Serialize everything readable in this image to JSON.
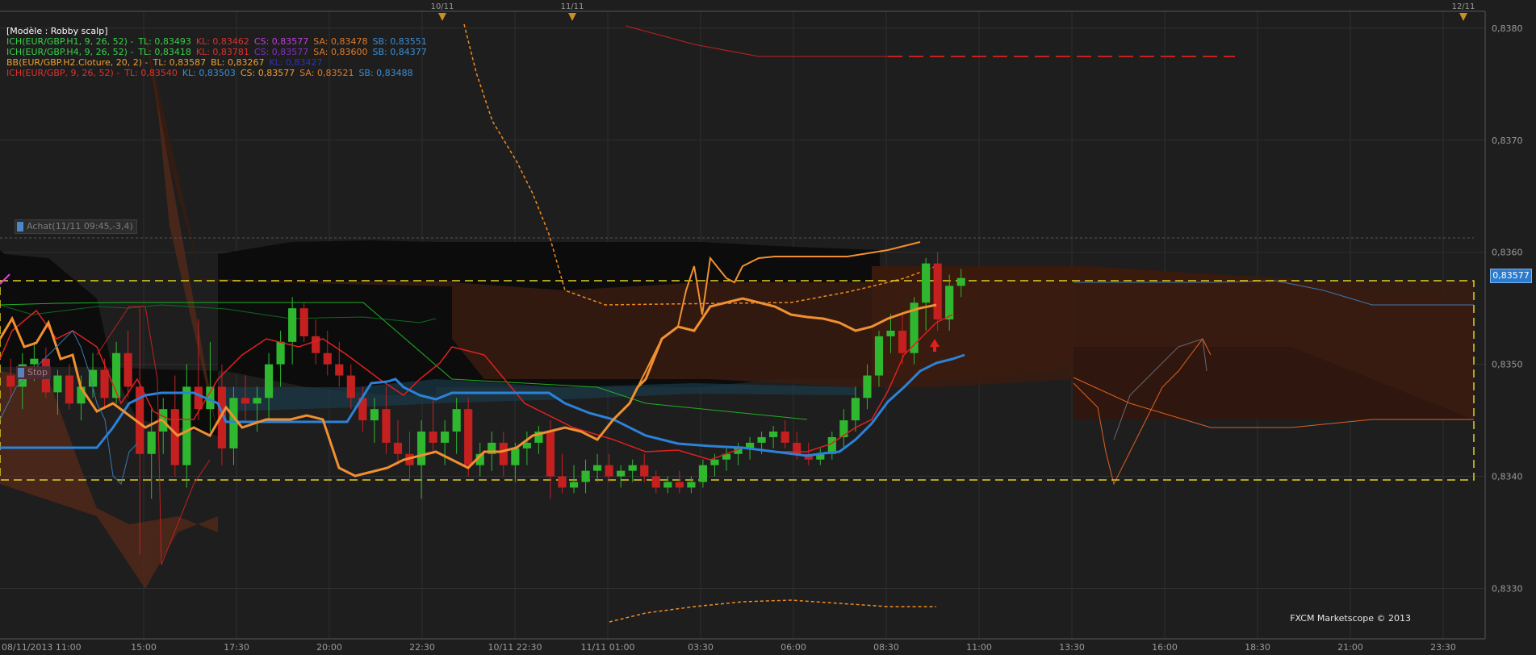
{
  "legend": {
    "model": "[Modèle : Robby scalp]",
    "rows": [
      [
        {
          "text": "ICH(EUR/GBP.H1, 9, 26, 52) -",
          "color": "#36d14a"
        },
        {
          "text": "TL: 0,83493",
          "color": "#36d14a"
        },
        {
          "text": "KL: 0,83462",
          "color": "#e03030"
        },
        {
          "text": "CS: 0,83577",
          "color": "#c040e0"
        },
        {
          "text": "SA: 0,83478",
          "color": "#e07a2a"
        },
        {
          "text": "SB: 0,83551",
          "color": "#3a8fd8"
        }
      ],
      [
        {
          "text": "ICH(EUR/GBP.H4, 9, 26, 52) -",
          "color": "#36d14a"
        },
        {
          "text": "TL: 0,83418",
          "color": "#36d14a"
        },
        {
          "text": "KL: 0,83781",
          "color": "#e03030"
        },
        {
          "text": "CS: 0,83577",
          "color": "#8030c0"
        },
        {
          "text": "SA: 0,83600",
          "color": "#e07a2a"
        },
        {
          "text": "SB: 0,84377",
          "color": "#3a8fd8"
        }
      ],
      [
        {
          "text": "BB(EUR/GBP.H2.Cloture, 20, 2) -",
          "color": "#f0a030"
        },
        {
          "text": "TL: 0,83587",
          "color": "#f0a030"
        },
        {
          "text": "BL: 0,83267",
          "color": "#f0a030"
        },
        {
          "text": "KL: 0,83427",
          "color": "#3030c0"
        }
      ],
      [
        {
          "text": "ICH(EUR/GBP, 9, 26, 52) -",
          "color": "#e03030"
        },
        {
          "text": "TL: 0,83540",
          "color": "#e03030"
        },
        {
          "text": "KL: 0,83503",
          "color": "#3a8fd8"
        },
        {
          "text": "CS: 0,83577",
          "color": "#f0a030"
        },
        {
          "text": "SA: 0,83521",
          "color": "#e07a2a"
        },
        {
          "text": "SB: 0,83488",
          "color": "#3a8fd8"
        }
      ]
    ]
  },
  "order_label": "Achat(11/11 09:45,-3,4)",
  "stop_label": "Stop",
  "current_price": "0,83577",
  "copyright": "FXCM Marketscope © 2013",
  "chart_data": {
    "type": "candlestick",
    "instrument": "EUR/GBP",
    "y_ticks": [
      "0,8380",
      "0,8370",
      "0,8360",
      "0,8350",
      "0,8340",
      "0,8330"
    ],
    "ylim": [
      0.83255,
      0.83815
    ],
    "x_ticks": [
      "08/11/2013 11:00",
      "15:00",
      "17:30",
      "20:00",
      "22:30",
      "10/11 22:30",
      "11/11 01:00",
      "03:30",
      "06:00",
      "08:30",
      "11:00",
      "13:30",
      "16:00",
      "18:30",
      "21:00",
      "23:30"
    ],
    "top_date_markers": [
      "10/11",
      "11/11",
      "12/11"
    ],
    "colors": {
      "up": "#2fb82f",
      "down": "#c42020",
      "background": "#1e1e1e",
      "grid": "#2e2e2e"
    },
    "candles": [
      [
        0.8349,
        0.83505,
        0.8347,
        0.8348
      ],
      [
        0.8348,
        0.8351,
        0.8346,
        0.835
      ],
      [
        0.835,
        0.8352,
        0.83485,
        0.83505
      ],
      [
        0.83505,
        0.83515,
        0.8347,
        0.83475
      ],
      [
        0.83475,
        0.83495,
        0.83455,
        0.8349
      ],
      [
        0.8349,
        0.835,
        0.8346,
        0.83465
      ],
      [
        0.83465,
        0.8349,
        0.8345,
        0.8348
      ],
      [
        0.8348,
        0.8351,
        0.8347,
        0.83495
      ],
      [
        0.83495,
        0.83505,
        0.8346,
        0.8347
      ],
      [
        0.8347,
        0.8352,
        0.83465,
        0.8351
      ],
      [
        0.8351,
        0.8353,
        0.8347,
        0.8348
      ],
      [
        0.8348,
        0.8355,
        0.8333,
        0.8342
      ],
      [
        0.8342,
        0.8346,
        0.8338,
        0.8344
      ],
      [
        0.8344,
        0.8347,
        0.8342,
        0.8346
      ],
      [
        0.8346,
        0.8349,
        0.834,
        0.8341
      ],
      [
        0.8341,
        0.835,
        0.8339,
        0.8348
      ],
      [
        0.8348,
        0.8354,
        0.8345,
        0.8346
      ],
      [
        0.8346,
        0.8352,
        0.8344,
        0.8348
      ],
      [
        0.8348,
        0.835,
        0.8341,
        0.83425
      ],
      [
        0.83425,
        0.8348,
        0.8341,
        0.8347
      ],
      [
        0.8347,
        0.8349,
        0.8345,
        0.83465
      ],
      [
        0.83465,
        0.8348,
        0.8344,
        0.8347
      ],
      [
        0.8347,
        0.8351,
        0.8345,
        0.835
      ],
      [
        0.835,
        0.8353,
        0.8348,
        0.8352
      ],
      [
        0.8352,
        0.8356,
        0.835,
        0.8355
      ],
      [
        0.8355,
        0.83555,
        0.8352,
        0.83525
      ],
      [
        0.83525,
        0.8354,
        0.835,
        0.8351
      ],
      [
        0.8351,
        0.8353,
        0.8349,
        0.835
      ],
      [
        0.835,
        0.8352,
        0.8348,
        0.8349
      ],
      [
        0.8349,
        0.835,
        0.8346,
        0.8347
      ],
      [
        0.8347,
        0.8348,
        0.8344,
        0.8345
      ],
      [
        0.8345,
        0.8347,
        0.8343,
        0.8346
      ],
      [
        0.8346,
        0.8348,
        0.8342,
        0.8343
      ],
      [
        0.8343,
        0.8345,
        0.8341,
        0.8342
      ],
      [
        0.8342,
        0.8344,
        0.83395,
        0.8341
      ],
      [
        0.8341,
        0.8345,
        0.8338,
        0.8344
      ],
      [
        0.8344,
        0.8347,
        0.8342,
        0.8343
      ],
      [
        0.8343,
        0.8345,
        0.8341,
        0.8344
      ],
      [
        0.8344,
        0.8347,
        0.8342,
        0.8346
      ],
      [
        0.8346,
        0.8347,
        0.834,
        0.8341
      ],
      [
        0.8341,
        0.8343,
        0.834,
        0.8342
      ],
      [
        0.8342,
        0.8344,
        0.83405,
        0.8343
      ],
      [
        0.8343,
        0.8344,
        0.834,
        0.8341
      ],
      [
        0.8341,
        0.8343,
        0.83395,
        0.83425
      ],
      [
        0.83425,
        0.8344,
        0.8341,
        0.8343
      ],
      [
        0.8343,
        0.83445,
        0.8342,
        0.8344
      ],
      [
        0.8344,
        0.8345,
        0.8338,
        0.834
      ],
      [
        0.834,
        0.8342,
        0.83385,
        0.8339
      ],
      [
        0.8339,
        0.8341,
        0.83385,
        0.83395
      ],
      [
        0.83395,
        0.83415,
        0.83385,
        0.83405
      ],
      [
        0.83405,
        0.8342,
        0.83395,
        0.8341
      ],
      [
        0.8341,
        0.8342,
        0.83395,
        0.834
      ],
      [
        0.834,
        0.8341,
        0.8339,
        0.83405
      ],
      [
        0.83405,
        0.83415,
        0.83395,
        0.8341
      ],
      [
        0.8341,
        0.8342,
        0.83395,
        0.834
      ],
      [
        0.834,
        0.83405,
        0.83385,
        0.8339
      ],
      [
        0.8339,
        0.834,
        0.83385,
        0.83395
      ],
      [
        0.83395,
        0.83405,
        0.83385,
        0.8339
      ],
      [
        0.8339,
        0.834,
        0.83385,
        0.83395
      ],
      [
        0.83395,
        0.83415,
        0.8339,
        0.8341
      ],
      [
        0.8341,
        0.8342,
        0.834,
        0.83415
      ],
      [
        0.83415,
        0.83425,
        0.83405,
        0.8342
      ],
      [
        0.8342,
        0.8343,
        0.8341,
        0.83425
      ],
      [
        0.83425,
        0.83435,
        0.83415,
        0.8343
      ],
      [
        0.8343,
        0.8344,
        0.8342,
        0.83435
      ],
      [
        0.83435,
        0.83445,
        0.83425,
        0.8344
      ],
      [
        0.8344,
        0.8345,
        0.83425,
        0.8343
      ],
      [
        0.8343,
        0.8344,
        0.83415,
        0.8342
      ],
      [
        0.8342,
        0.8343,
        0.8341,
        0.83415
      ],
      [
        0.83415,
        0.83425,
        0.8341,
        0.8342
      ],
      [
        0.8342,
        0.8344,
        0.83415,
        0.83435
      ],
      [
        0.83435,
        0.8346,
        0.83425,
        0.8345
      ],
      [
        0.8345,
        0.8348,
        0.8344,
        0.8347
      ],
      [
        0.8347,
        0.835,
        0.8346,
        0.8349
      ],
      [
        0.8349,
        0.8353,
        0.8348,
        0.83525
      ],
      [
        0.83525,
        0.83545,
        0.8351,
        0.8353
      ],
      [
        0.8353,
        0.83545,
        0.835,
        0.8351
      ],
      [
        0.8351,
        0.8356,
        0.835,
        0.83555
      ],
      [
        0.83555,
        0.83595,
        0.8353,
        0.8359
      ],
      [
        0.8359,
        0.836,
        0.8353,
        0.8354
      ],
      [
        0.8354,
        0.8358,
        0.8353,
        0.8357
      ],
      [
        0.8357,
        0.83585,
        0.8356,
        0.83577
      ]
    ]
  }
}
